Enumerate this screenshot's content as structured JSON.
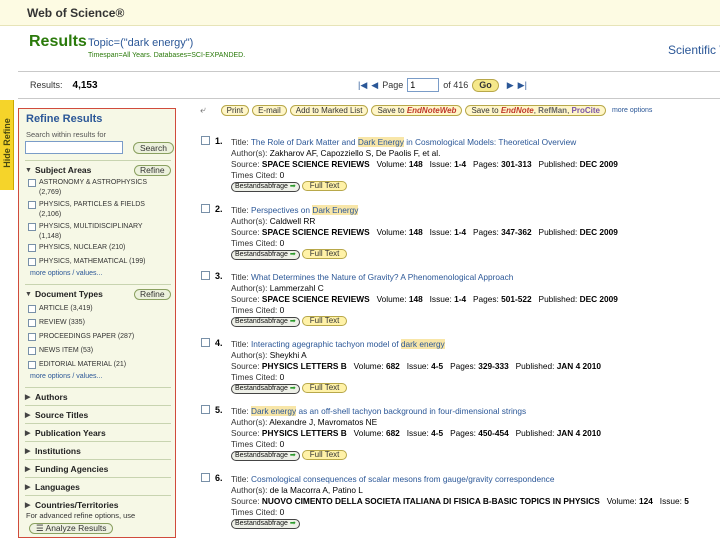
{
  "app": {
    "brand": "Web of Science®"
  },
  "header": {
    "title": "Results",
    "topic": "Topic=(\"dark energy\")",
    "subtitle": "Timespan=All Years. Databases=SCI-EXPANDED.",
    "logo": "Scientific W"
  },
  "results": {
    "label": "Results:",
    "count": "4,153"
  },
  "pager": {
    "page_label": "Page",
    "page_value": "1",
    "of_label": "of 416",
    "go_label": "Go"
  },
  "hide_tab": "Hide Refine",
  "refine": {
    "title": "Refine Results",
    "search_label": "Search within results for",
    "search_button": "Search",
    "refine_button": "Refine",
    "subject_areas": {
      "label": "Subject Areas",
      "items": [
        {
          "name": "ASTRONOMY & ASTROPHYSICS",
          "count": "(2,769)"
        },
        {
          "name": "PHYSICS, PARTICLES & FIELDS",
          "count": "(2,106)"
        },
        {
          "name": "PHYSICS, MULTIDISCIPLINARY",
          "count": "(1,148)"
        },
        {
          "name": "PHYSICS, NUCLEAR (210)",
          "count": ""
        },
        {
          "name": "PHYSICS, MATHEMATICAL (199)",
          "count": ""
        }
      ],
      "more": "more options / values..."
    },
    "document_types": {
      "label": "Document Types",
      "items": [
        {
          "name": "ARTICLE (3,419)"
        },
        {
          "name": "REVIEW (335)"
        },
        {
          "name": "PROCEEDINGS PAPER (287)"
        },
        {
          "name": "NEWS ITEM (53)"
        },
        {
          "name": "EDITORIAL MATERIAL (21)"
        }
      ],
      "more": "more options / values..."
    },
    "collapsed": [
      "Authors",
      "Source Titles",
      "Publication Years",
      "Institutions",
      "Funding Agencies",
      "Languages",
      "Countries/Territories"
    ],
    "advanced_note": "For advanced refine options, use",
    "analyze_button": "Analyze Results"
  },
  "toolbar": {
    "print": "Print",
    "email": "E-mail",
    "marked": "Add to Marked List",
    "save_endnote_prefix": "Save to",
    "endnote": "EndNote",
    "web": "Web",
    "save_to": "Save to",
    "refman": "RefMan",
    "procite": "ProCite",
    "more_options": "more options"
  },
  "labels": {
    "title": "Title:",
    "authors": "Author(s):",
    "source": "Source:",
    "volume": "Volume:",
    "issue": "Issue:",
    "pages": "Pages:",
    "published": "Published:",
    "times_cited": "Times Cited:",
    "bestand": "Bestandsabfrage",
    "full_text": "Full Text"
  },
  "records": [
    {
      "num": "1.",
      "title_pre": "The Role of Dark Matter and ",
      "title_hl": "Dark Energy",
      "title_post": " in Cosmological Models: Theoretical Overview",
      "authors": "Zakharov AF, Capozziello S, De Paolis F, et al.",
      "source": "SPACE SCIENCE REVIEWS",
      "volume": "148",
      "issue": "1-4",
      "pages": "301-313",
      "published": "DEC 2009",
      "cited": "0"
    },
    {
      "num": "2.",
      "title_pre": "Perspectives on ",
      "title_hl": "Dark Energy",
      "title_post": "",
      "authors": "Caldwell RR",
      "source": "SPACE SCIENCE REVIEWS",
      "volume": "148",
      "issue": "1-4",
      "pages": "347-362",
      "published": "DEC 2009",
      "cited": "0"
    },
    {
      "num": "3.",
      "title_pre": "What Determines the Nature of Gravity? A Phenomenological Approach",
      "title_hl": "",
      "title_post": "",
      "authors": "Lammerzahl C",
      "source": "SPACE SCIENCE REVIEWS",
      "volume": "148",
      "issue": "1-4",
      "pages": "501-522",
      "published": "DEC 2009",
      "cited": "0"
    },
    {
      "num": "4.",
      "title_pre": "Interacting agegraphic tachyon model of ",
      "title_hl": "dark energy",
      "title_post": "",
      "authors": "Sheykhi A",
      "source": "PHYSICS LETTERS B",
      "volume": "682",
      "issue": "4-5",
      "pages": "329-333",
      "published": "JAN 4 2010",
      "cited": "0"
    },
    {
      "num": "5.",
      "title_pre": "",
      "title_hl": "Dark energy",
      "title_post": " as an off-shell tachyon background in four-dimensional strings",
      "authors": "Alexandre J, Mavromatos NE",
      "source": "PHYSICS LETTERS B",
      "volume": "682",
      "issue": "4-5",
      "pages": "450-454",
      "published": "JAN 4 2010",
      "cited": "0"
    },
    {
      "num": "6.",
      "title_pre": "Cosmological consequences of scalar mesons from gauge/gravity correspondence",
      "title_hl": "",
      "title_post": "",
      "authors": "de la Macorra A, Patino L",
      "source": "NUOVO CIMENTO DELLA SOCIETA ITALIANA DI FISICA B-BASIC TOPICS IN PHYSICS",
      "volume": "124",
      "issue": "5",
      "pages": "",
      "published": "",
      "cited": "0"
    }
  ]
}
